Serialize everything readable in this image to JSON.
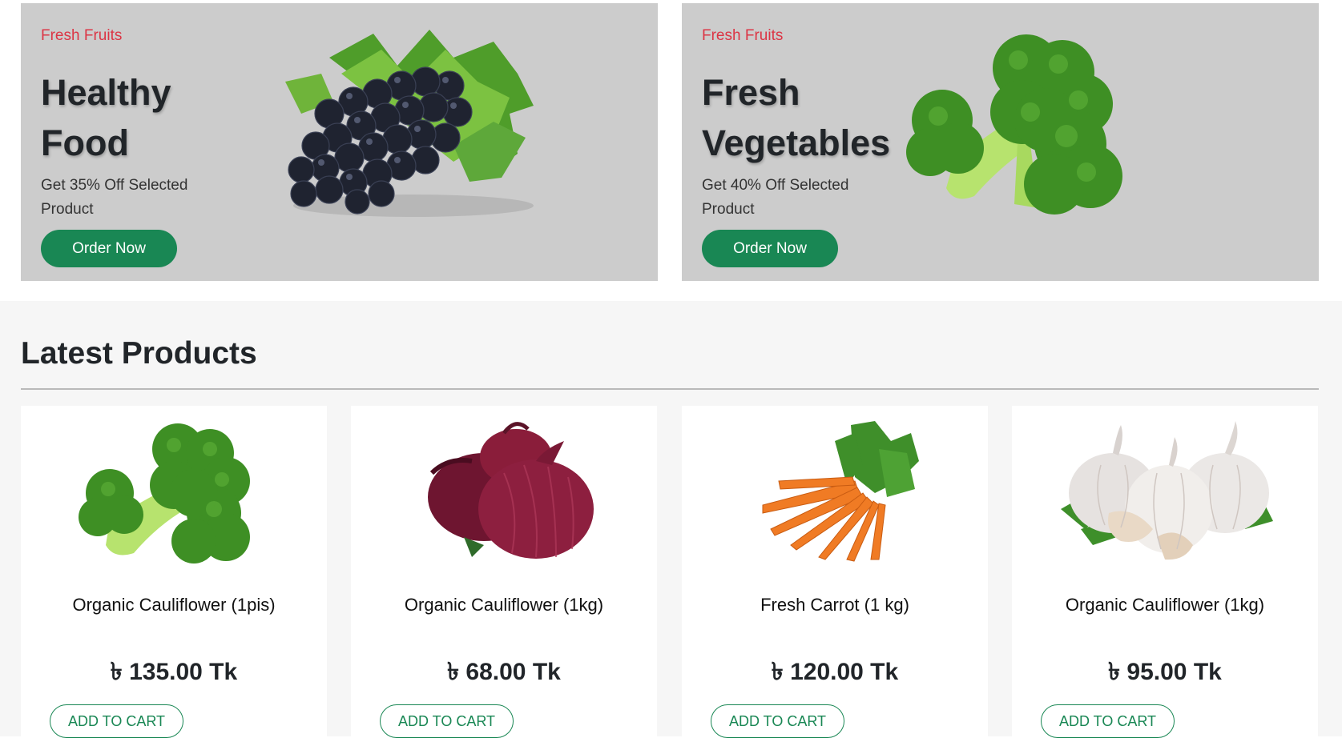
{
  "banners": [
    {
      "eyebrow": "Fresh Fruits",
      "headline": "Healthy Food",
      "subtitle": "Get 35% Off Selected Product",
      "button": "Order Now",
      "image": "grapes-image"
    },
    {
      "eyebrow": "Fresh Fruits",
      "headline": "Fresh Vegetables",
      "subtitle": "Get 40% Off Selected Product",
      "button": "Order Now",
      "image": "broccoli-image"
    }
  ],
  "latest": {
    "title": "Latest Products",
    "products": [
      {
        "name": "Organic Cauliflower (1pis)",
        "price": "৳ 135.00 Tk",
        "button": "ADD TO CART",
        "image": "broccoli-image"
      },
      {
        "name": "Organic Cauliflower (1kg)",
        "price": "৳ 68.00 Tk",
        "button": "ADD TO CART",
        "image": "red-onion-image"
      },
      {
        "name": "Fresh Carrot (1 kg)",
        "price": "৳ 120.00 Tk",
        "button": "ADD TO CART",
        "image": "carrot-image"
      },
      {
        "name": "Organic Cauliflower (1kg)",
        "price": "৳ 95.00 Tk",
        "button": "ADD TO CART",
        "image": "garlic-image"
      }
    ]
  },
  "colors": {
    "accent": "#198754",
    "eyebrow": "#dc3545",
    "banner_bg": "#cccccc",
    "section_bg": "#f6f6f6"
  }
}
